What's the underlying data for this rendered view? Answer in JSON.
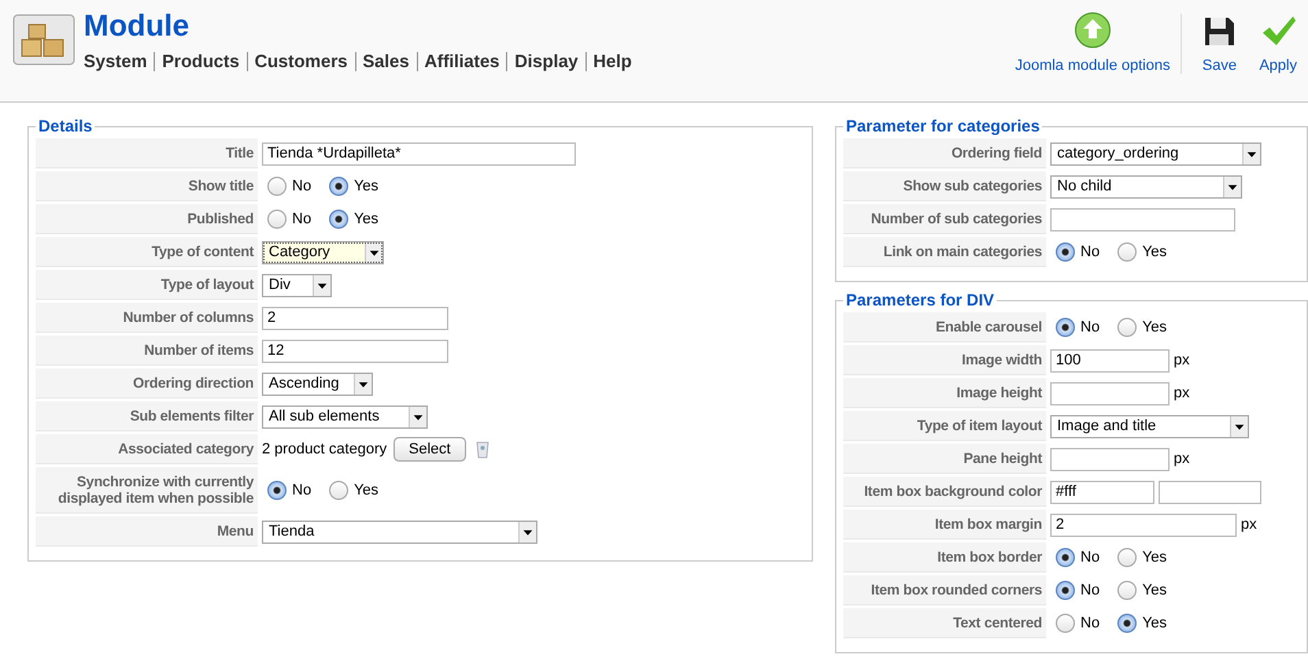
{
  "header": {
    "title": "Module",
    "menu": [
      "System",
      "Products",
      "Customers",
      "Sales",
      "Affiliates",
      "Display",
      "Help"
    ],
    "toolbar": [
      {
        "kind": "options",
        "label": "Joomla module options"
      },
      {
        "kind": "save",
        "label": "Save"
      },
      {
        "kind": "apply",
        "label": "Apply"
      }
    ]
  },
  "details": {
    "legend": "Details",
    "rows": [
      {
        "kind": "text",
        "label": "Title",
        "value": "Tienda *Urdapilleta*"
      },
      {
        "kind": "radio",
        "label": "Show title",
        "options": [
          {
            "label": "No",
            "selected": false
          },
          {
            "label": "Yes",
            "selected": true
          }
        ]
      },
      {
        "kind": "radio",
        "label": "Published",
        "options": [
          {
            "label": "No",
            "selected": false
          },
          {
            "label": "Yes",
            "selected": true
          }
        ]
      },
      {
        "kind": "select",
        "label": "Type of content",
        "value": "Category",
        "focused": true
      },
      {
        "kind": "select",
        "label": "Type of layout",
        "value": "Div"
      },
      {
        "kind": "text",
        "label": "Number of columns",
        "value": "2"
      },
      {
        "kind": "text",
        "label": "Number of items",
        "value": "12"
      },
      {
        "kind": "select",
        "label": "Ordering direction",
        "value": "Ascending"
      },
      {
        "kind": "select",
        "label": "Sub elements filter",
        "value": "All sub elements"
      },
      {
        "kind": "category",
        "label": "Associated category",
        "value": "2 product category",
        "button": "Select"
      },
      {
        "kind": "radio",
        "label": "Synchronize with currently displayed item when possible",
        "options": [
          {
            "label": "No",
            "selected": true
          },
          {
            "label": "Yes",
            "selected": false
          }
        ]
      },
      {
        "kind": "select",
        "label": "Menu",
        "value": "Tienda"
      }
    ]
  },
  "categories": {
    "legend": "Parameter for categories",
    "rows": [
      {
        "kind": "select",
        "label": "Ordering field",
        "value": "category_ordering"
      },
      {
        "kind": "select",
        "label": "Show sub categories",
        "value": "No child"
      },
      {
        "kind": "text",
        "label": "Number of sub categories"
      },
      {
        "kind": "radio",
        "label": "Link on main categories",
        "options": [
          {
            "label": "No",
            "selected": true
          },
          {
            "label": "Yes",
            "selected": false
          }
        ]
      }
    ]
  },
  "div": {
    "legend": "Parameters for DIV",
    "rows": [
      {
        "kind": "radio",
        "label": "Enable carousel",
        "options": [
          {
            "label": "No",
            "selected": true
          },
          {
            "label": "Yes",
            "selected": false
          }
        ]
      },
      {
        "kind": "text",
        "label": "Image width",
        "value": "100",
        "unit": "px"
      },
      {
        "kind": "text",
        "label": "Image height",
        "unit": "px"
      },
      {
        "kind": "select",
        "label": "Type of item layout",
        "value": "Image and title"
      },
      {
        "kind": "text",
        "label": "Pane height",
        "unit": "px"
      },
      {
        "kind": "color",
        "label": "Item box background color",
        "value": "#fff"
      },
      {
        "kind": "text",
        "label": "Item box margin",
        "value": "2",
        "unit": "px"
      },
      {
        "kind": "radio",
        "label": "Item box border",
        "options": [
          {
            "label": "No",
            "selected": true
          },
          {
            "label": "Yes",
            "selected": false
          }
        ]
      },
      {
        "kind": "radio",
        "label": "Item box rounded corners",
        "options": [
          {
            "label": "No",
            "selected": true
          },
          {
            "label": "Yes",
            "selected": false
          }
        ]
      },
      {
        "kind": "radio",
        "label": "Text centered",
        "options": [
          {
            "label": "No",
            "selected": false
          },
          {
            "label": "Yes",
            "selected": true
          }
        ]
      }
    ]
  }
}
